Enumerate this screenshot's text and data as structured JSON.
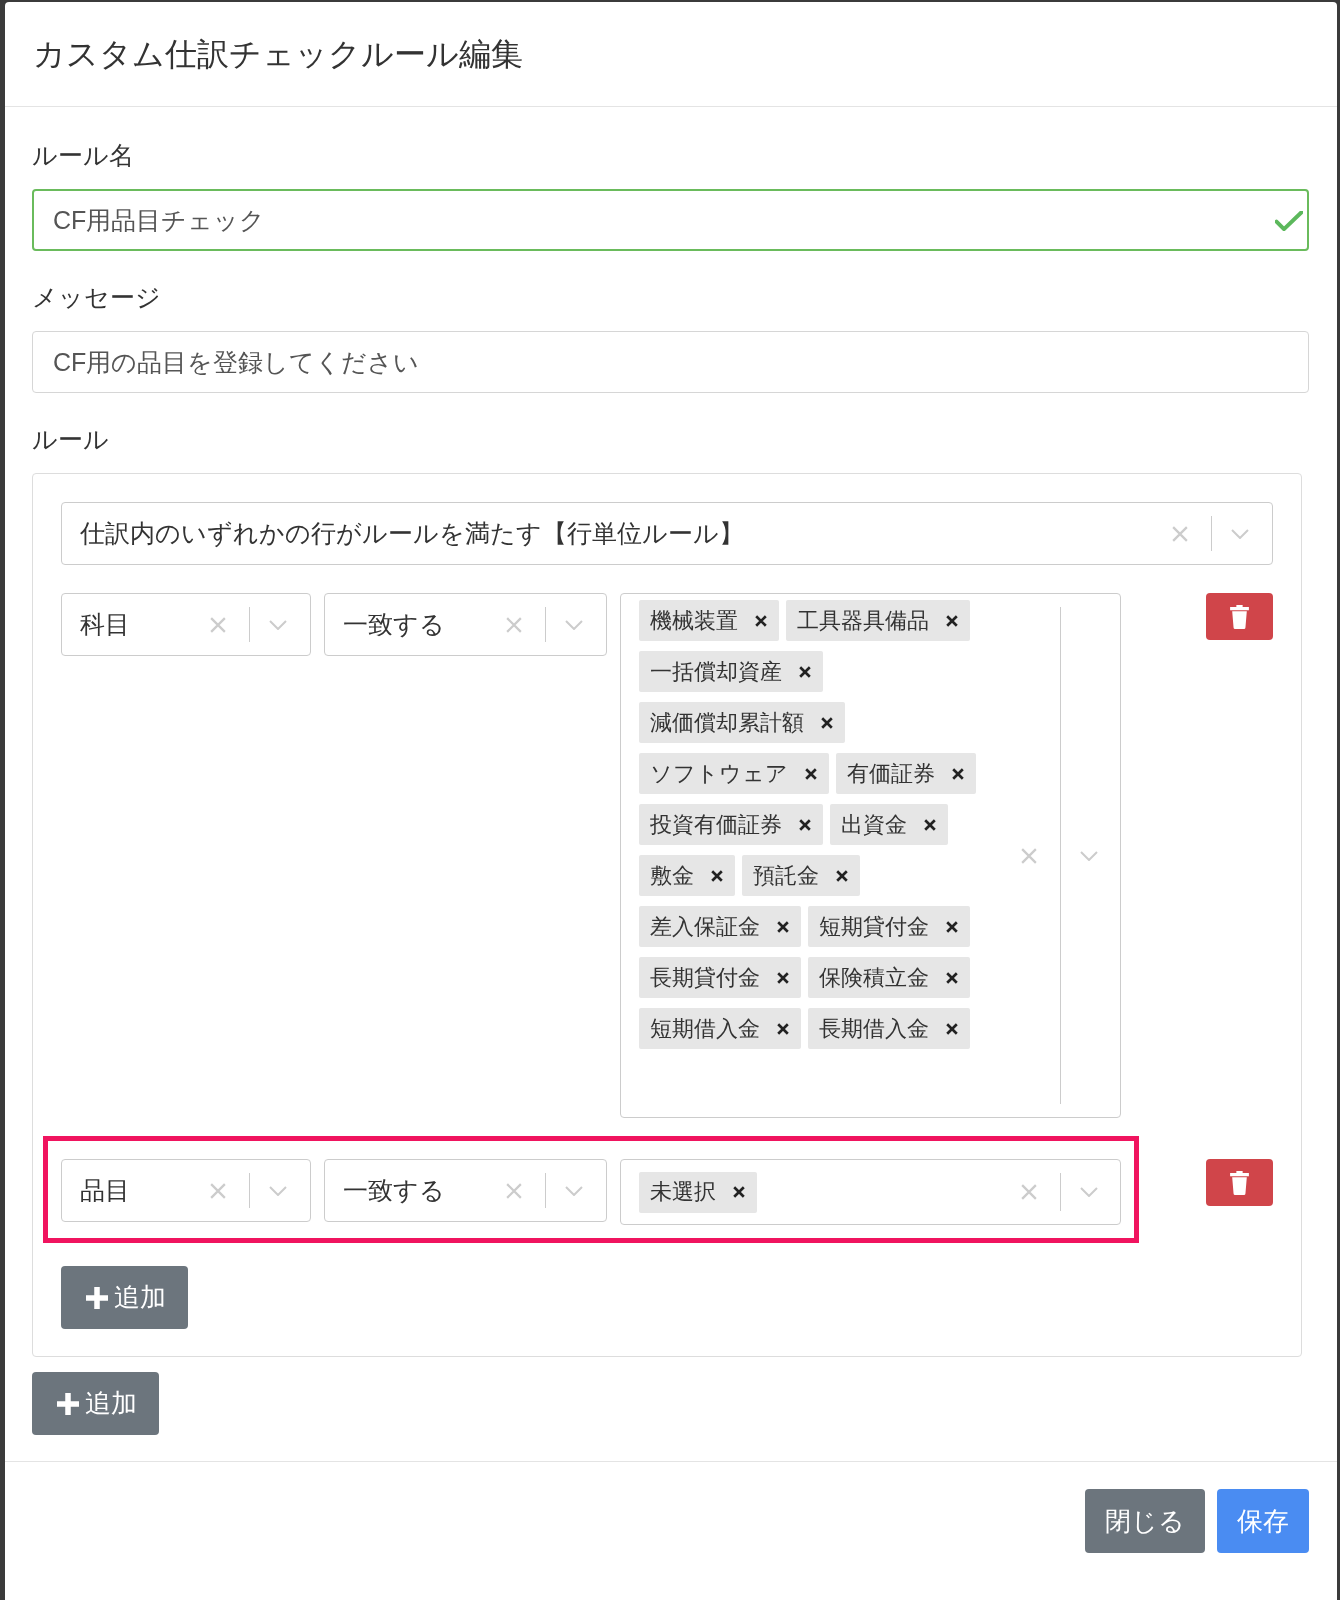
{
  "dialog": {
    "title": "カスタム仕訳チェックルール編集"
  },
  "fields": [
    {
      "label": "ルール名",
      "value": "CF用品目チェック",
      "valid": true
    },
    {
      "label": "メッセージ",
      "value": "CF用の品目を登録してください",
      "valid": false
    }
  ],
  "rules": {
    "label": "ルール",
    "scope": "仕訳内のいずれかの行がルールを満たす【行単位ルール】",
    "conditions": [
      {
        "field": "科目",
        "operator": "一致する",
        "values": [
          "機械装置",
          "工具器具備品",
          "一括償却資産",
          "減価償却累計額",
          "ソフトウェア",
          "有価証券",
          "投資有価証券",
          "出資金",
          "敷金",
          "預託金",
          "差入保証金",
          "短期貸付金",
          "長期貸付金",
          "保険積立金",
          "短期借入金",
          "長期借入金"
        ],
        "highlighted": false
      },
      {
        "field": "品目",
        "operator": "一致する",
        "values": [
          "未選択"
        ],
        "highlighted": true
      }
    ],
    "add_button": {
      "label": "追加"
    }
  },
  "add_button": {
    "label": "追加"
  },
  "footer": {
    "buttons": [
      {
        "label": "閉じる",
        "kind": "secondary"
      },
      {
        "label": "保存",
        "kind": "primary"
      }
    ]
  }
}
